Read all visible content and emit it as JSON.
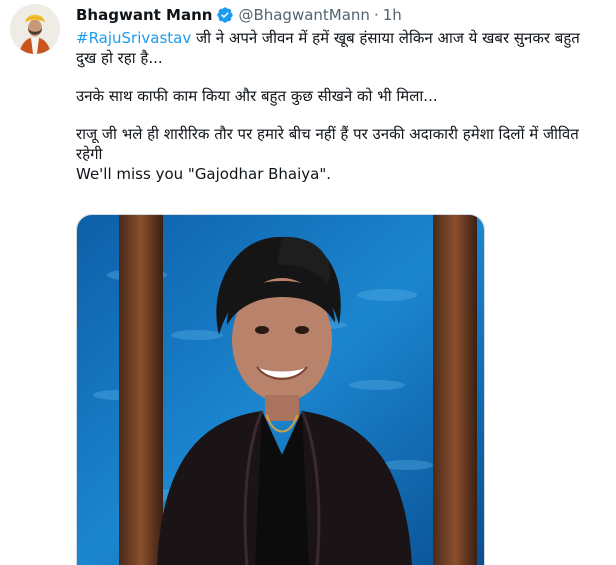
{
  "tweet": {
    "author_name": "Bhagwant Mann",
    "handle": "@BhagwantMann",
    "separator": "·",
    "time": "1h",
    "verified_icon": "verified-badge-icon",
    "hashtag": "#RajuSrivastav",
    "line1_rest": " जी ने अपने जीवन में हमें खूब हंसाया लेकिन आज ये खबर सुनकर बहुत दुख हो रहा है...",
    "line2": "उनके साथ काफी काम किया और बहुत कुछ सीखने को भी मिला...",
    "line3": "राजू जी भले ही शारीरिक तौर पर हमारे बीच नहीं हैं पर उनकी अदाकारी हमेशा दिलों में जीवित रहेगी",
    "line4": "We'll miss you \"Gajodhar Bhaiya\".",
    "colors": {
      "link": "#1d9bf0",
      "verified": "#1d9bf0",
      "secondary_text": "#536471"
    }
  }
}
